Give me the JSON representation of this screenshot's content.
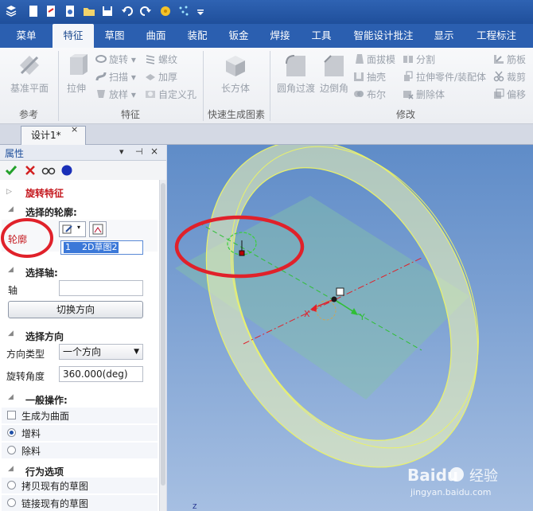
{
  "menu": {
    "tabs": [
      "菜单",
      "特征",
      "草图",
      "曲面",
      "装配",
      "钣金",
      "焊接",
      "工具",
      "智能设计批注",
      "显示",
      "工程标注"
    ],
    "active": "特征"
  },
  "ribbon": {
    "reference": {
      "datum_plane": "基准平面",
      "group_label": "参考"
    },
    "feature": {
      "extrude": "拉伸",
      "revolve": "旋转",
      "sweep": "扫描",
      "loft": "放样",
      "thread": "螺纹",
      "thicken": "加厚",
      "custom_hole": "自定义孔",
      "group_label": "特征"
    },
    "quick": {
      "box": "长方体",
      "group_label": "快速生成图素"
    },
    "modify": {
      "fillet": "圆角过渡",
      "chamfer": "边倒角",
      "draft": "面拔模",
      "shell": "抽壳",
      "boolean": "布尔",
      "split": "分割",
      "extrude_to_part": "拉伸零件/装配体",
      "delete_body": "删除体",
      "rib": "筋板",
      "trim": "裁剪",
      "offset": "偏移",
      "group_label": "修改"
    }
  },
  "document": {
    "tab_title": "设计1*",
    "close": "×"
  },
  "panel": {
    "title": "属性",
    "header_icons": [
      "▾",
      "⊣",
      "×"
    ],
    "feature_title": "旋转特征",
    "section_profile": "选择的轮廓:",
    "profile_label": "轮廓",
    "profile_value": "1    2D草图2",
    "section_axis": "选择轴:",
    "axis_label": "轴",
    "axis_value": "",
    "switch_direction": "切换方向",
    "section_direction": "选择方向",
    "direction_type_label": "方向类型",
    "direction_type_value": "一个方向",
    "rotation_angle_label": "旋转角度",
    "rotation_angle_value": "360.000(deg)",
    "section_general": "一般操作:",
    "generate_surface": "生成为曲面",
    "add_material": "增料",
    "remove_material": "除料",
    "section_behavior": "行为选项",
    "copy_sketch": "拷贝现有的草图",
    "link_sketch": "链接现有的草图"
  },
  "viewport": {
    "axis_x": "X",
    "axis_y": "Y",
    "axis_z": "Z",
    "annotation_color": "#e0212a",
    "ring_color": "#e9f28a",
    "plane_color": "#7fbfa5"
  },
  "watermark": {
    "brand": "Baidu",
    "jingyan": "经验",
    "url": "jingyan.baidu.com"
  }
}
